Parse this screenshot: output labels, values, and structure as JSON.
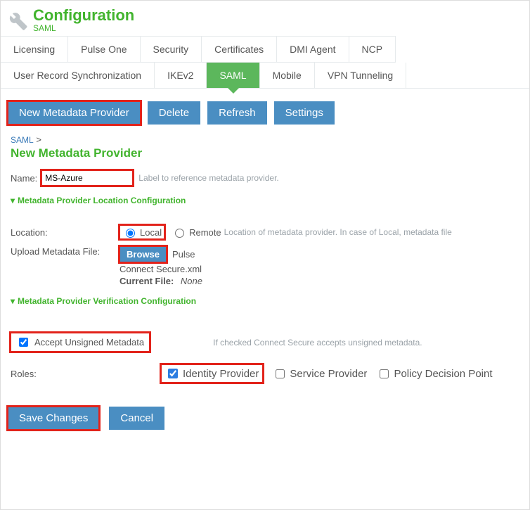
{
  "header": {
    "title": "Configuration",
    "subtitle": "SAML"
  },
  "tabs_row1": [
    "Licensing",
    "Pulse One",
    "Security",
    "Certificates",
    "DMI Agent",
    "NCP"
  ],
  "tabs_row2": [
    "User Record Synchronization",
    "IKEv2",
    "SAML",
    "Mobile",
    "VPN Tunneling"
  ],
  "active_tab": "SAML",
  "toolbar": {
    "new_provider": "New Metadata Provider",
    "delete": "Delete",
    "refresh": "Refresh",
    "settings": "Settings"
  },
  "crumb": {
    "parent": "SAML",
    "sep": ">"
  },
  "page_title": "New Metadata Provider",
  "name": {
    "label": "Name:",
    "value": "MS-Azure",
    "hint": "Label to reference metadata provider."
  },
  "loc_section": "Metadata Provider Location Configuration",
  "location": {
    "label": "Location:",
    "local": "Local",
    "remote": "Remote",
    "hint": "Location of metadata provider. In case of Local, metadata file"
  },
  "upload": {
    "label": "Upload Metadata File:",
    "browse": "Browse",
    "file_line1": "Pulse",
    "file_line2": "Connect Secure.xml",
    "current_label": "Current File:",
    "current_value": "None"
  },
  "ver_section": "Metadata Provider Verification Configuration",
  "accept": {
    "label": "Accept Unsigned Metadata",
    "hint": "If checked Connect Secure accepts unsigned metadata."
  },
  "roles": {
    "label": "Roles:",
    "idp": "Identity Provider",
    "sp": "Service Provider",
    "pdp": "Policy Decision Point"
  },
  "footer": {
    "save": "Save Changes",
    "cancel": "Cancel"
  }
}
